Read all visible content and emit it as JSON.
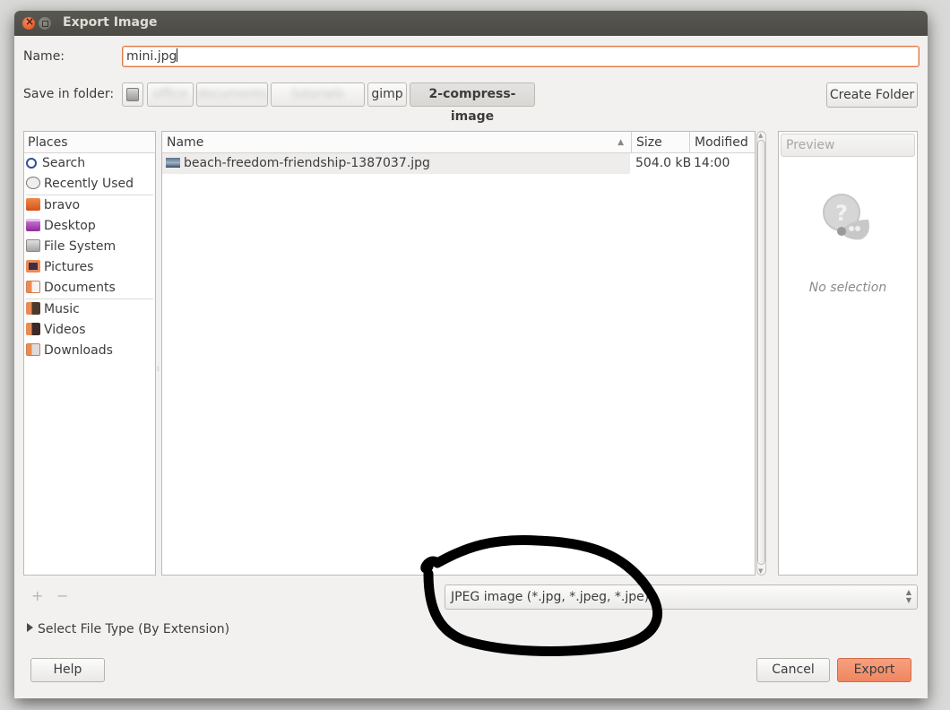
{
  "window": {
    "title": "Export Image",
    "controls": {
      "close": "close-icon",
      "maximize": "maximize-icon"
    }
  },
  "name_field": {
    "label": "Name:",
    "value": "mini.jpg"
  },
  "folder_bar": {
    "label": "Save in folder:",
    "root_icon": "hard-disk-icon",
    "segments": [
      {
        "label": "office",
        "obscured": true
      },
      {
        "label": "documents",
        "obscured": true
      },
      {
        "label": "tutorials",
        "obscured": true
      },
      {
        "label": "gimp",
        "obscured": false
      },
      {
        "label": "2-compress-image",
        "obscured": false,
        "active": true
      }
    ],
    "create_folder_label": "Create Folder"
  },
  "places": {
    "header": "Places",
    "groups": [
      [
        {
          "label": "Search",
          "icon": "search-icon"
        },
        {
          "label": "Recently Used",
          "icon": "clock-icon"
        }
      ],
      [
        {
          "label": "bravo",
          "icon": "home-folder-icon"
        },
        {
          "label": "Desktop",
          "icon": "desktop-icon"
        },
        {
          "label": "File System",
          "icon": "hard-disk-icon"
        },
        {
          "label": "Pictures",
          "icon": "pictures-folder-icon"
        },
        {
          "label": "Documents",
          "icon": "documents-folder-icon"
        }
      ],
      [
        {
          "label": "Music",
          "icon": "music-folder-icon"
        },
        {
          "label": "Videos",
          "icon": "videos-folder-icon"
        },
        {
          "label": "Downloads",
          "icon": "downloads-folder-icon"
        }
      ]
    ],
    "add_label": "+",
    "remove_label": "−"
  },
  "file_list": {
    "columns": {
      "name": "Name",
      "size": "Size",
      "modified": "Modified"
    },
    "sort_indicator": "▲",
    "rows": [
      {
        "name": "beach-freedom-friendship-1387037.jpg",
        "size": "504.0 kB",
        "modified": "14:00",
        "icon": "image-thumbnail-icon"
      }
    ]
  },
  "preview": {
    "header": "Preview",
    "empty_text": "No selection",
    "icon": "gimp-question-icon"
  },
  "file_type_filter": {
    "selected": "JPEG image (*.jpg, *.jpeg, *.jpe)"
  },
  "select_file_type": {
    "label": "Select File Type (By Extension)"
  },
  "buttons": {
    "help": "Help",
    "cancel": "Cancel",
    "export": "Export"
  },
  "colors": {
    "accent": "#f08b67",
    "focus_border": "#e07a45",
    "titlebar": "#4f4d48"
  },
  "annotation": {
    "shape": "hand-drawn ellipse",
    "color": "#000000",
    "target": "file-type-filter"
  }
}
